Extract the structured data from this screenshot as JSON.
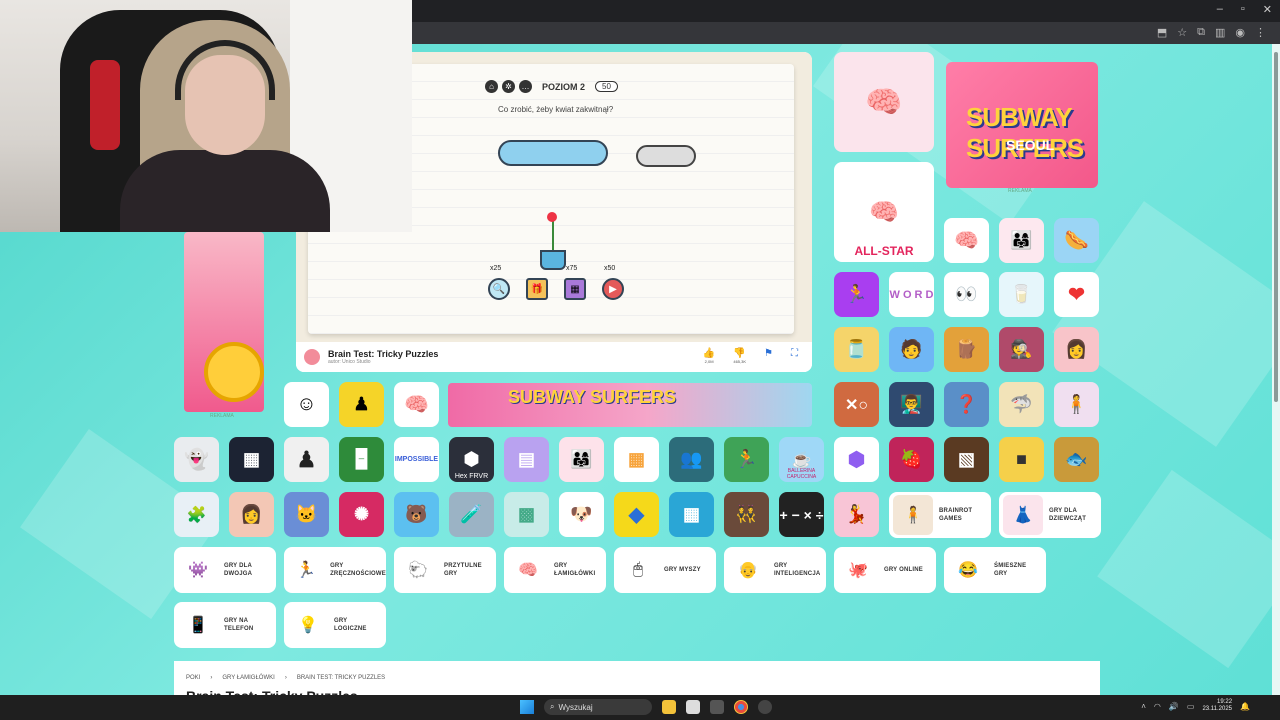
{
  "game": {
    "level_label": "POZIOM 2",
    "coins": "50",
    "question": "Co zrobić, żeby kwiat zakwitnął?",
    "costs": [
      "x25",
      "x75",
      "x50"
    ],
    "title": "Brain Test: Tricky Puzzles",
    "author": "autor: Unico Studio",
    "likes": "2,0M",
    "dislikes": "465,3K"
  },
  "ads": {
    "label": "REKLAMA",
    "right_logo": "SUBWAY SURFERS",
    "right_logo_sub": "SEOUL",
    "banner_logo": "SUBWAY SURFERS"
  },
  "tiles": {
    "all_star": "ALL-STAR",
    "hex": "Hex FRVR",
    "ballerina": "BALLERINA CAPUCCINA",
    "impossible": "IMPOSSIBLE"
  },
  "categories": [
    {
      "label": "GRY DLA\nDWOJGA",
      "icon": "two-players-icon"
    },
    {
      "label": "GRY\nZRĘCZNOŚCIOWE",
      "icon": "skill-icon"
    },
    {
      "label": "PRZYTULNE\nGRY",
      "icon": "cozy-icon"
    },
    {
      "label": "GRY\nŁAMIGŁÓWKI",
      "icon": "brain-icon"
    },
    {
      "label": "GRY MYSZY",
      "icon": "mouse-icon"
    },
    {
      "label": "GRY\nINTELIGENCJA",
      "icon": "intelligence-icon"
    },
    {
      "label": "GRY ONLINE",
      "icon": "online-icon"
    },
    {
      "label": "ŚMIESZNE\nGRY",
      "icon": "laugh-icon"
    },
    {
      "label": "GRY NA\nTELEFON",
      "icon": "phone-icon"
    },
    {
      "label": "GRY\nLOGICZNE",
      "icon": "bulb-icon"
    },
    {
      "label": "BRAINROT\nGAMES",
      "icon": "brainrot-icon"
    },
    {
      "label": "GRY DLA\nDZIEWCZĄT",
      "icon": "girl-icon"
    }
  ],
  "breadcrumb": [
    "POKI",
    "GRY ŁAMIGŁÓWKI",
    "BRAIN TEST: TRICKY PUZZLES"
  ],
  "page_title": "Brain Test: Tricky Puzzles",
  "taskbar": {
    "search_placeholder": "Wyszukaj",
    "time": "19:22",
    "date": "23.11.2025"
  },
  "colors": {
    "background": "#5fe0d6",
    "accent_blue": "#2a6fd6"
  }
}
